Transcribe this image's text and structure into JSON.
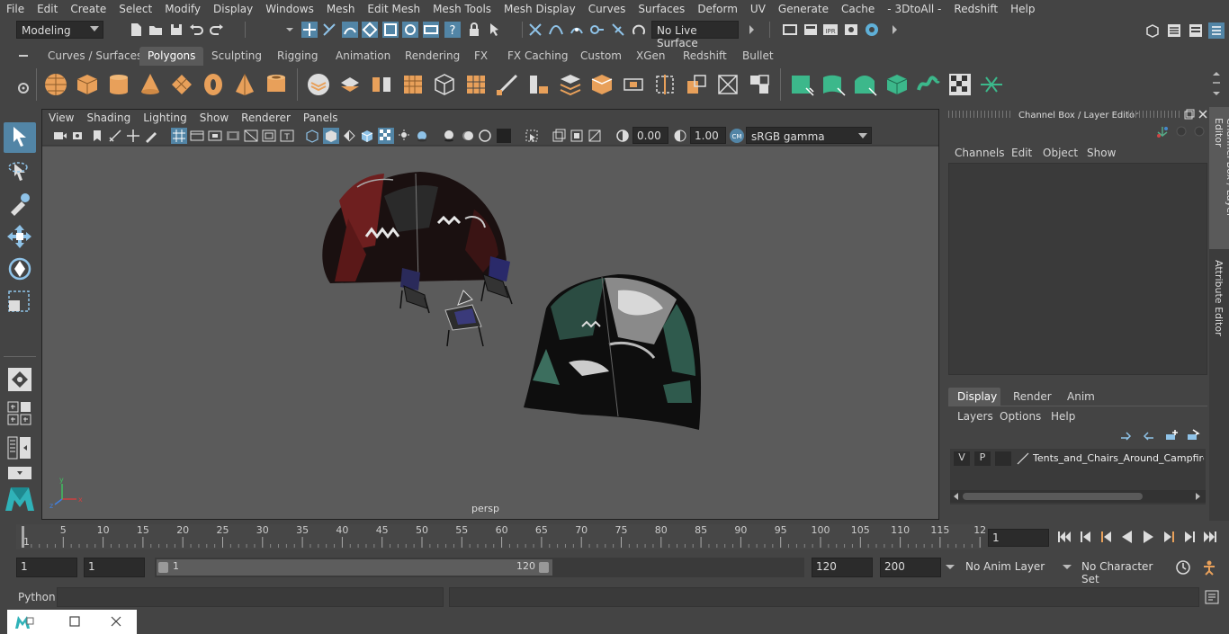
{
  "menubar": {
    "items": [
      "File",
      "Edit",
      "Create",
      "Select",
      "Modify",
      "Display",
      "Windows",
      "Mesh",
      "Edit Mesh",
      "Mesh Tools",
      "Mesh Display",
      "Curves",
      "Surfaces",
      "Deform",
      "UV",
      "Generate",
      "Cache",
      "- 3DtoAll -",
      "Redshift",
      "Help"
    ]
  },
  "status": {
    "mode": "Modeling",
    "live_surface": "No Live Surface"
  },
  "shelf": {
    "tabs": [
      "Curves / Surfaces",
      "Polygons",
      "Sculpting",
      "Rigging",
      "Animation",
      "Rendering",
      "FX",
      "FX Caching",
      "Custom",
      "XGen",
      "Redshift",
      "Bullet"
    ],
    "active_tab": "Polygons"
  },
  "viewport": {
    "menu": [
      "View",
      "Shading",
      "Lighting",
      "Show",
      "Renderer",
      "Panels"
    ],
    "exposure": "0.00",
    "gamma": "1.00",
    "color_space": "sRGB gamma",
    "camera_label": "persp"
  },
  "channel_box": {
    "title": "Channel Box / Layer Editor",
    "menu": [
      "Channels",
      "Edit",
      "Object",
      "Show"
    ],
    "layer_tabs": [
      "Display",
      "Render",
      "Anim"
    ],
    "active_layer_tab": "Display",
    "layer_menu": [
      "Layers",
      "Options",
      "Help"
    ],
    "layer": {
      "v": "V",
      "p": "P",
      "name": "Tents_and_Chairs_Around_Campfire_"
    }
  },
  "side_tabs": {
    "channel_box": "Channel Box / Layer Editor",
    "attribute_editor": "Attribute Editor"
  },
  "timeline": {
    "ticks": [
      "1",
      "5",
      "10",
      "15",
      "20",
      "25",
      "30",
      "35",
      "40",
      "45",
      "50",
      "55",
      "60",
      "65",
      "70",
      "75",
      "80",
      "85",
      "90",
      "95",
      "100",
      "105",
      "110",
      "115",
      "12"
    ],
    "current_frame": "1"
  },
  "range": {
    "start": "1",
    "playback_start": "1",
    "slider_start": "1",
    "slider_end": "120",
    "playback_end": "120",
    "end": "200",
    "anim_layer": "No Anim Layer",
    "character_set": "No Character Set"
  },
  "command_line": {
    "label": "Python"
  },
  "colors": {
    "accent": "#5285a6",
    "background": "#444444",
    "viewport": "#5b5b5b",
    "shelf_icon": "#e8a05a",
    "shelf_icon_green": "#3cb88b"
  }
}
